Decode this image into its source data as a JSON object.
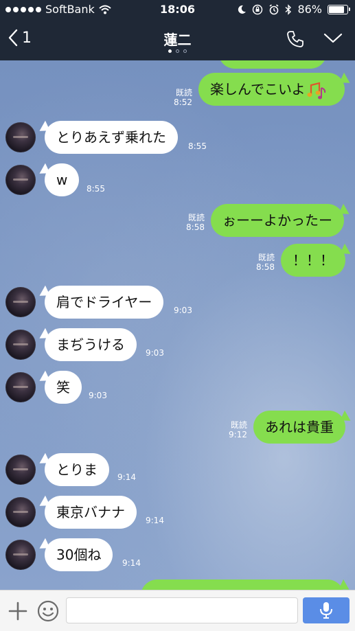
{
  "status_bar": {
    "carrier": "SoftBank",
    "time": "18:06",
    "battery": "86%"
  },
  "header": {
    "back_count": "1",
    "title": "蓮二"
  },
  "messages": [
    {
      "side": "out",
      "text": "楽しんでこいよ",
      "read": "既読",
      "time": "8:52"
    },
    {
      "side": "in",
      "text": "とりあえず乗れた",
      "time": "8:55"
    },
    {
      "side": "in",
      "text": "w",
      "time": "8:55"
    },
    {
      "side": "out",
      "text": "ぉーーよかったー",
      "read": "既読",
      "time": "8:58"
    },
    {
      "side": "out",
      "text": "！！！",
      "read": "既読",
      "time": "8:58"
    },
    {
      "side": "in",
      "text": "肩でドライヤー",
      "time": "9:03"
    },
    {
      "side": "in",
      "text": "まぢうける",
      "time": "9:03"
    },
    {
      "side": "in",
      "text": "笑",
      "time": "9:03"
    },
    {
      "side": "out",
      "text": "あれは貴重",
      "read": "既読",
      "time": "9:12"
    },
    {
      "side": "in",
      "text": "とりま",
      "time": "9:14"
    },
    {
      "side": "in",
      "text": "東京バナナ",
      "time": "9:14"
    },
    {
      "side": "in",
      "text": "30個ね",
      "time": "9:14"
    }
  ],
  "input": {
    "value": ""
  },
  "colors": {
    "header_bg": "#1f2836",
    "outgoing_bubble": "#85dd4e",
    "incoming_bubble": "#ffffff",
    "mic_button": "#5a8de6"
  }
}
